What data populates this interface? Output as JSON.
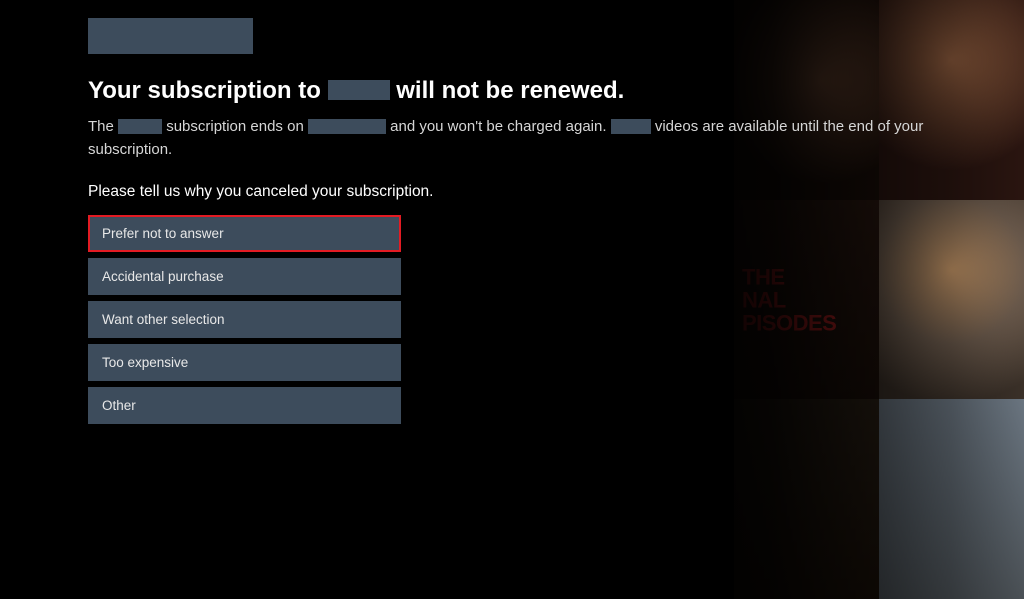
{
  "title": {
    "prefix": "Your subscription to",
    "suffix": "will not be renewed."
  },
  "subtext": {
    "p1a": "The",
    "p1b": "subscription ends on",
    "p1c": "and you won't be charged again.",
    "p1d": "videos are available until the end of your subscription."
  },
  "question": "Please tell us why you canceled your subscription.",
  "options": [
    {
      "label": "Prefer not to answer",
      "selected": true
    },
    {
      "label": "Accidental purchase",
      "selected": false
    },
    {
      "label": "Want other selection",
      "selected": false
    },
    {
      "label": "Too expensive",
      "selected": false
    },
    {
      "label": "Other",
      "selected": false
    }
  ],
  "bg_tile_text": {
    "line1": "THE",
    "line2": "NAL",
    "line3": "PISODES"
  }
}
